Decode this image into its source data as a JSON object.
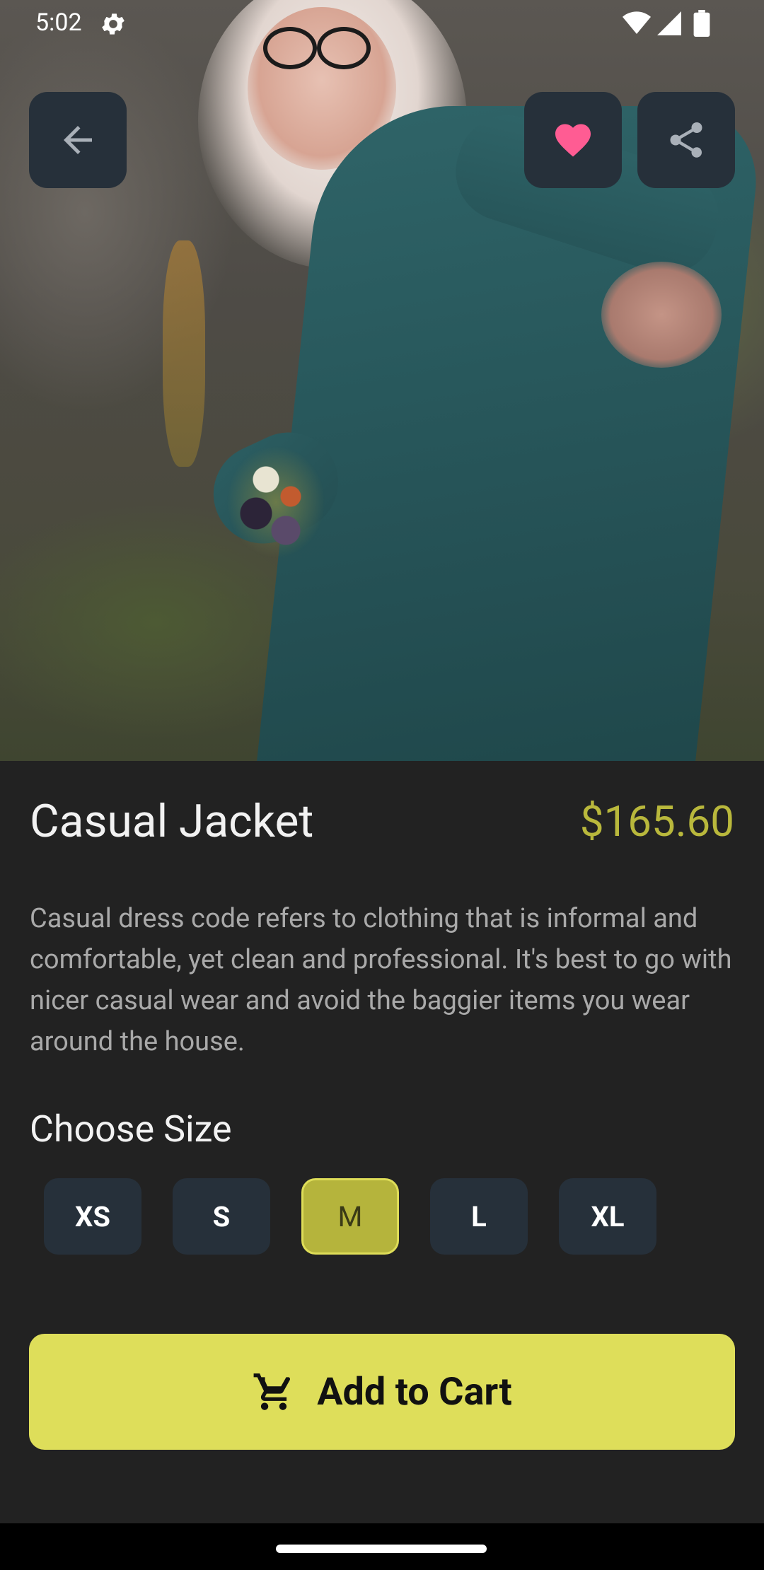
{
  "status_bar": {
    "time": "5:02",
    "icons": [
      "settings-gear-icon",
      "wifi-icon",
      "cellular-signal-icon",
      "battery-icon"
    ]
  },
  "header": {
    "buttons": [
      {
        "name": "back-button",
        "icon": "arrow-left-icon"
      },
      {
        "name": "favorite-button",
        "icon": "heart-icon",
        "color": "#ff5c93"
      },
      {
        "name": "share-button",
        "icon": "share-icon"
      }
    ]
  },
  "product": {
    "name": "Casual Jacket",
    "price": "$165.60",
    "price_color": "#b9b83c",
    "description": "Casual dress code refers to clothing that is informal and comfortable, yet clean and professional. It's best to go with nicer casual wear and avoid the baggier items you wear around the house."
  },
  "sizes": {
    "title": "Choose Size",
    "options": [
      "XS",
      "S",
      "M",
      "L",
      "XL"
    ],
    "selected": "M"
  },
  "cart": {
    "label": "Add to Cart",
    "icon": "shopping-cart-icon",
    "color": "#dede5a"
  }
}
